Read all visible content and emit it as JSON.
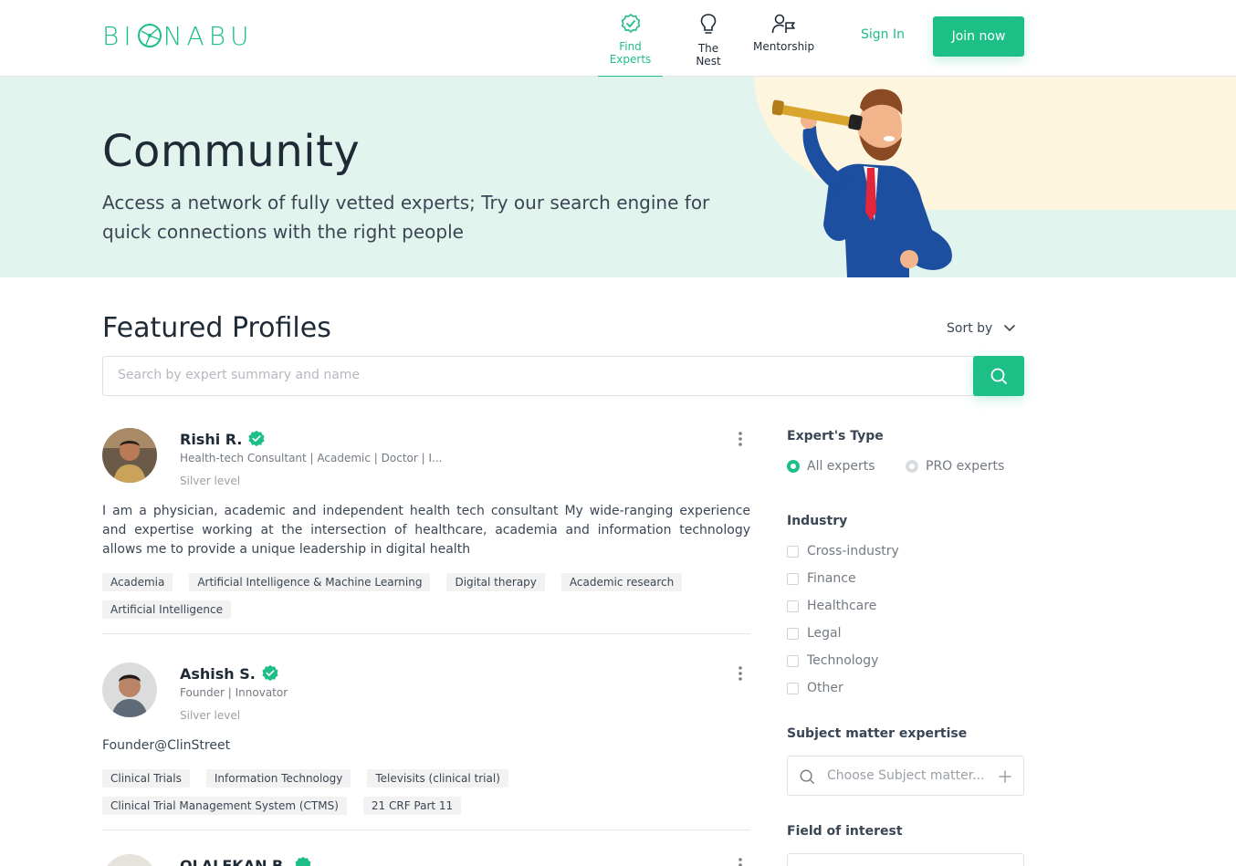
{
  "brand": {
    "logo_prefix": "BI",
    "logo_suffix": "NABU",
    "accent": "#1ebf86"
  },
  "nav": {
    "items": [
      {
        "label": "Find Experts",
        "icon": "badge-check-icon",
        "active": true
      },
      {
        "label": "The Nest",
        "icon": "lightbulb-icon",
        "active": false
      },
      {
        "label": "Mentorship",
        "icon": "mentor-flag-icon",
        "active": false
      }
    ],
    "sign_in": "Sign In",
    "join": "Join now"
  },
  "hero": {
    "title": "Community",
    "subtitle": "Access a network of fully vetted experts; Try our search engine for quick connections with the right people"
  },
  "featured": {
    "title": "Featured Profiles",
    "sort_label": "Sort by",
    "search_placeholder": "Search by expert summary and name"
  },
  "profiles": [
    {
      "name": "Rishi R.",
      "headline": "Health-tech Consultant | Academic | Doctor | I...",
      "level": "Silver level",
      "summary": "I am a physician, academic and independent health tech consultant My wide-ranging experience and expertise working at the intersection of healthcare, academia and information technology allows me to provide a unique leadership in digital health",
      "tags": [
        "Academia",
        "Artificial Intelligence & Machine Learning",
        "Digital therapy",
        "Academic research",
        "Artificial Intelligence"
      ]
    },
    {
      "name": "Ashish S.",
      "headline": "Founder | Innovator",
      "level": "Silver level",
      "summary": "Founder@ClinStreet",
      "tags": [
        "Clinical Trials",
        "Information Technology",
        "Televisits (clinical trial)",
        "Clinical Trial Management System (CTMS)",
        "21 CRF Part 11"
      ]
    },
    {
      "name": "OLALEKAN B."
    }
  ],
  "filters": {
    "expert_type": {
      "title": "Expert's Type",
      "options": [
        {
          "label": "All experts",
          "selected": true
        },
        {
          "label": "PRO experts",
          "selected": false
        }
      ]
    },
    "industry": {
      "title": "Industry",
      "options": [
        "Cross-industry",
        "Finance",
        "Healthcare",
        "Legal",
        "Technology",
        "Other"
      ]
    },
    "subject": {
      "title": "Subject matter expertise",
      "placeholder": "Choose Subject matter..."
    },
    "field": {
      "title": "Field of interest"
    }
  }
}
